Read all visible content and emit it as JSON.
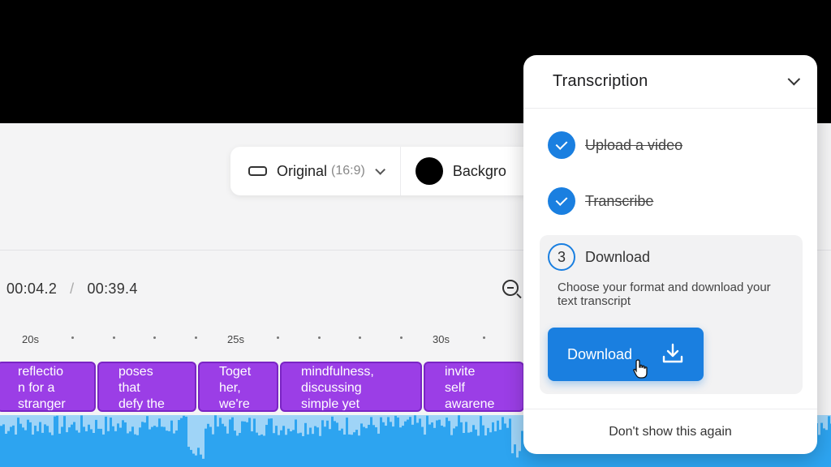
{
  "toolbar": {
    "aspect_label": "Original",
    "aspect_ratio": "(16:9)",
    "background_label": "Backgro",
    "background_color": "#000000"
  },
  "timeline": {
    "current_time": "00:04.2",
    "separator": "/",
    "total_time": "00:39.4",
    "ticks": [
      "20s",
      "25s",
      "30s"
    ],
    "clips": [
      {
        "line1": "reflectio",
        "line2": "n for a",
        "line3": "stranger"
      },
      {
        "line1": "poses",
        "line2": "that",
        "line3": "defy the"
      },
      {
        "line1": "Toget",
        "line2": "her,",
        "line3": "we're"
      },
      {
        "line1": "mindfulness,",
        "line2": "discussing",
        "line3": "simple yet"
      },
      {
        "line1": "invite",
        "line2": "self",
        "line3": "awarene"
      }
    ],
    "clip_color": "#9b3ee6",
    "waveform_color": "#2da4f0"
  },
  "panel": {
    "title": "Transcription",
    "steps": [
      {
        "label": "Upload a video",
        "status": "done"
      },
      {
        "label": "Transcribe",
        "status": "done"
      },
      {
        "number": "3",
        "label": "Download",
        "status": "active",
        "description": "Choose your format and download your text transcript"
      }
    ],
    "download_button": "Download",
    "dismiss_label": "Don't show this again",
    "accent_color": "#1a7fe0"
  }
}
